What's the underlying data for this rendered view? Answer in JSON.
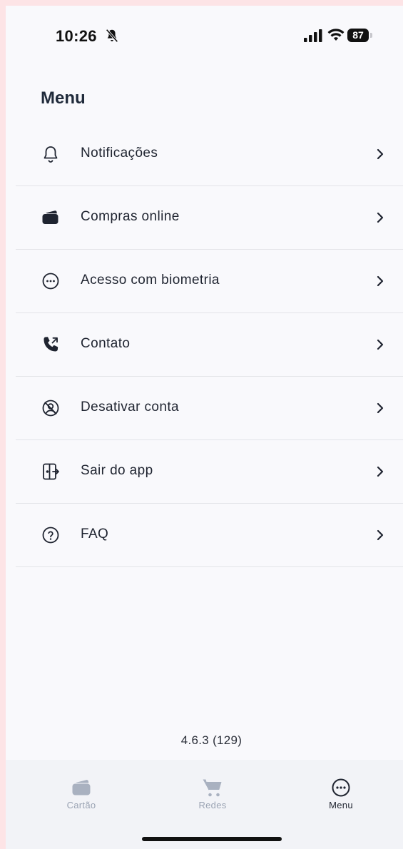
{
  "status_bar": {
    "time": "10:26",
    "battery": "87",
    "icons": [
      "bell-off-icon",
      "signal-icon",
      "wifi-icon",
      "battery-icon"
    ]
  },
  "header": {
    "title": "Menu"
  },
  "menu": {
    "items": [
      {
        "label": "Notificações",
        "icon": "bell-icon"
      },
      {
        "label": "Compras online",
        "icon": "card-icon"
      },
      {
        "label": "Acesso com biometria",
        "icon": "more-circle-icon"
      },
      {
        "label": "Contato",
        "icon": "phone-icon"
      },
      {
        "label": "Desativar conta",
        "icon": "deactivate-icon"
      },
      {
        "label": "Sair do app",
        "icon": "logout-icon"
      },
      {
        "label": "FAQ",
        "icon": "help-icon"
      }
    ]
  },
  "footer": {
    "version": "4.6.3 (129)"
  },
  "tab_bar": {
    "tabs": [
      {
        "label": "Cartão",
        "icon": "card-icon",
        "active": false
      },
      {
        "label": "Redes",
        "icon": "cart-icon",
        "active": false
      },
      {
        "label": "Menu",
        "icon": "more-circle-icon",
        "active": true
      }
    ]
  },
  "colors": {
    "background": "#f9f9fc",
    "tab_bar": "#f2f3f7",
    "inactive_tab": "#9aa3b3",
    "text": "#1f2430"
  }
}
